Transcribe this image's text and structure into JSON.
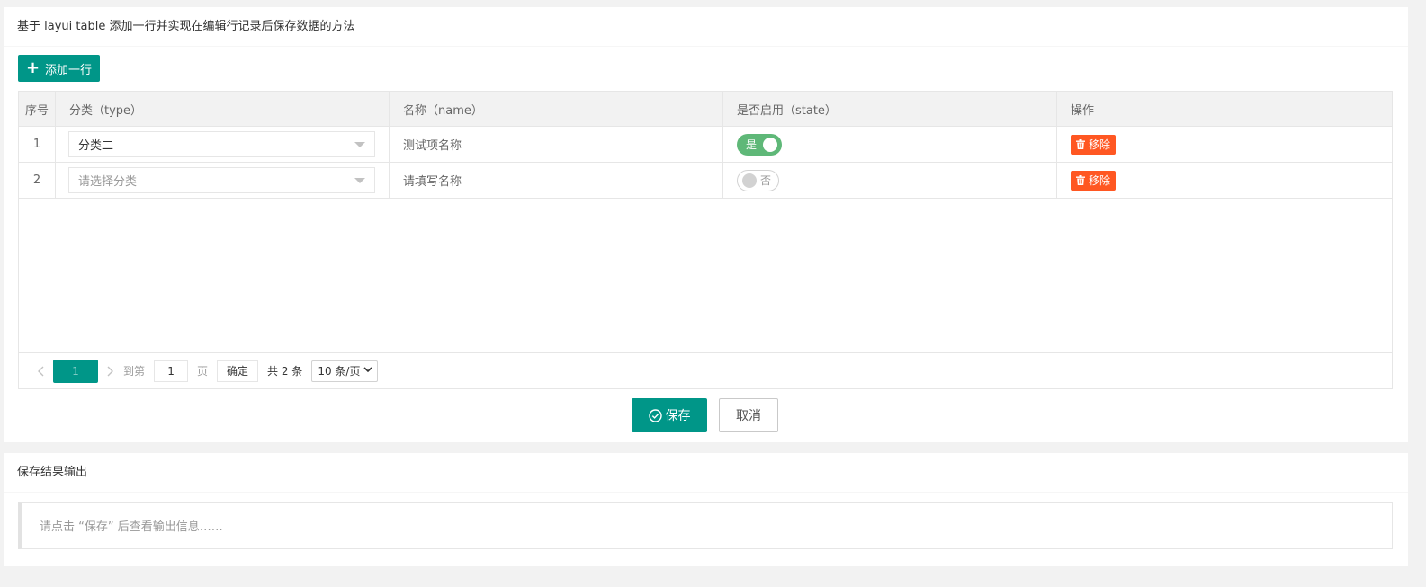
{
  "main": {
    "title": "基于 layui table 添加一行并实现在编辑行记录后保存数据的方法",
    "add_button": "添加一行",
    "save_button": "保存",
    "cancel_button": "取消"
  },
  "table": {
    "columns": [
      "序号",
      "分类（type）",
      "名称（name）",
      "是否启用（state）",
      "操作"
    ],
    "rows": [
      {
        "index": "1",
        "type": "分类二",
        "type_is_placeholder": false,
        "name": "测试项名称",
        "state": "是",
        "state_on": true,
        "action": "移除"
      },
      {
        "index": "2",
        "type": "请选择分类",
        "type_is_placeholder": true,
        "name": "请填写名称",
        "state": "否",
        "state_on": false,
        "action": "移除"
      }
    ]
  },
  "pager": {
    "current": "1",
    "goto_label": "到第",
    "goto_value": "1",
    "page_unit": "页",
    "confirm": "确定",
    "total": "共 2 条",
    "limit": "10 条/页"
  },
  "output": {
    "title": "保存结果输出",
    "message": "请点击 “保存” 后查看输出信息……"
  },
  "colors": {
    "primary": "#009688",
    "danger": "#FF5722",
    "switch_on": "#5FB878"
  }
}
